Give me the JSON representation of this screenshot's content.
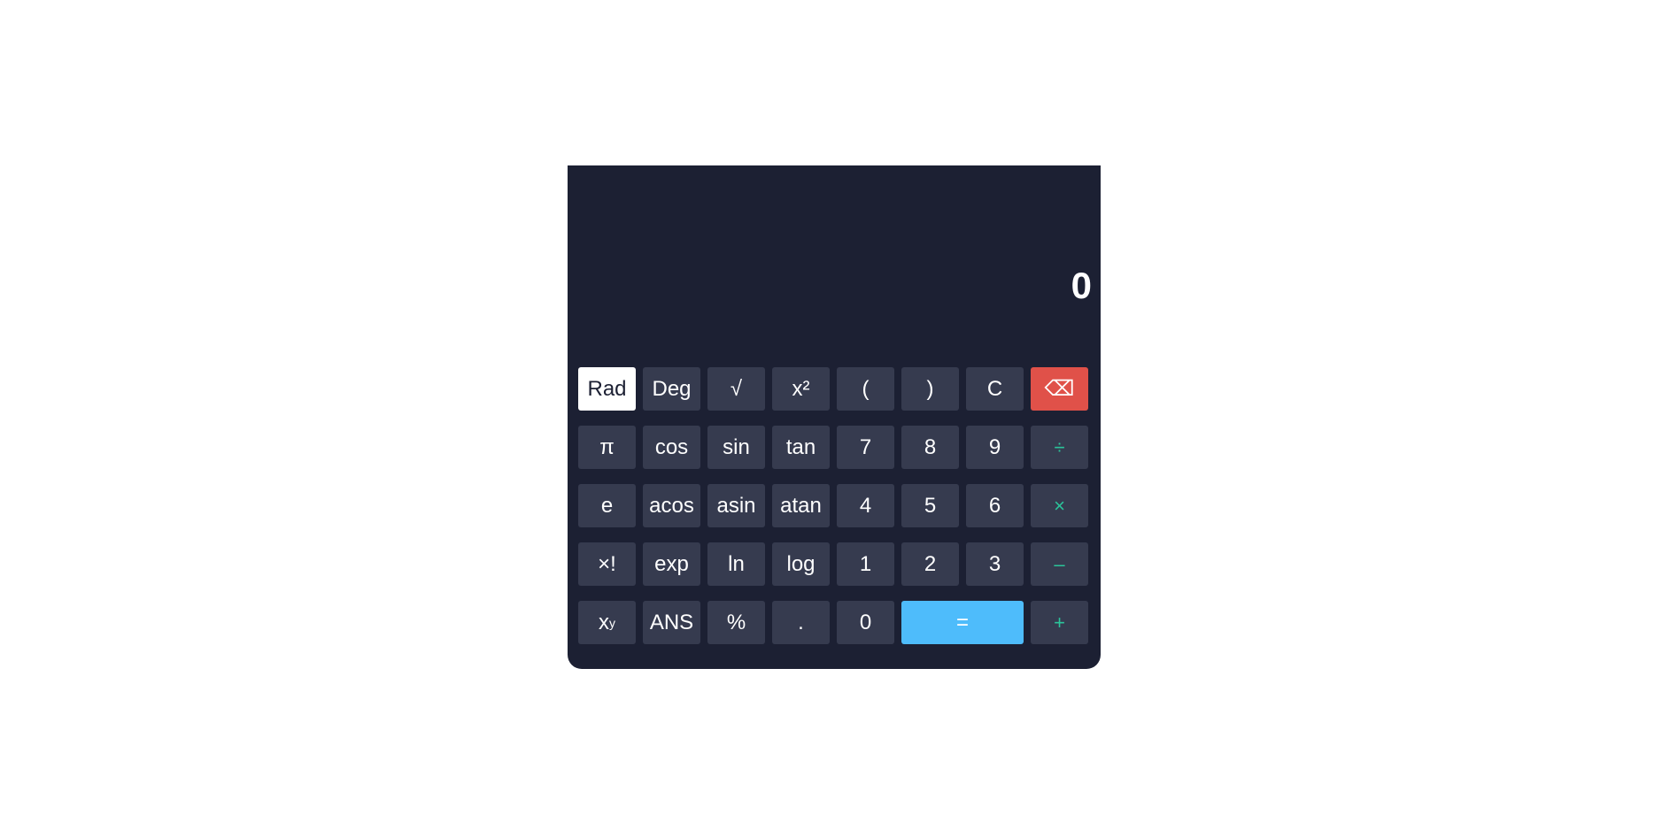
{
  "display": {
    "value": "0"
  },
  "keys": {
    "rad": "Rad",
    "deg": "Deg",
    "sqrt": "√",
    "square": "x²",
    "lparen": "(",
    "rparen": ")",
    "clear": "C",
    "backspace": "⌫",
    "pi": "π",
    "cos": "cos",
    "sin": "sin",
    "tan": "tan",
    "d7": "7",
    "d8": "8",
    "d9": "9",
    "divide": "÷",
    "e": "e",
    "acos": "acos",
    "asin": "asin",
    "atan": "atan",
    "d4": "4",
    "d5": "5",
    "d6": "6",
    "multiply": "×",
    "factorial": "×!",
    "exp": "exp",
    "ln": "ln",
    "log": "log",
    "d1": "1",
    "d2": "2",
    "d3": "3",
    "subtract": "–",
    "power_base": "x",
    "power_exp": "y",
    "ans": "ANS",
    "percent": "%",
    "decimal": ".",
    "d0": "0",
    "equals": "=",
    "add": "+"
  },
  "state": {
    "angle_mode": "Rad"
  },
  "colors": {
    "body_bg": "#1c2033",
    "key_bg": "#363b4f",
    "operator_text": "#2bc49a",
    "backspace_bg": "#e05149",
    "equals_bg": "#4ebcfb",
    "active_mode_bg": "#ffffff"
  }
}
